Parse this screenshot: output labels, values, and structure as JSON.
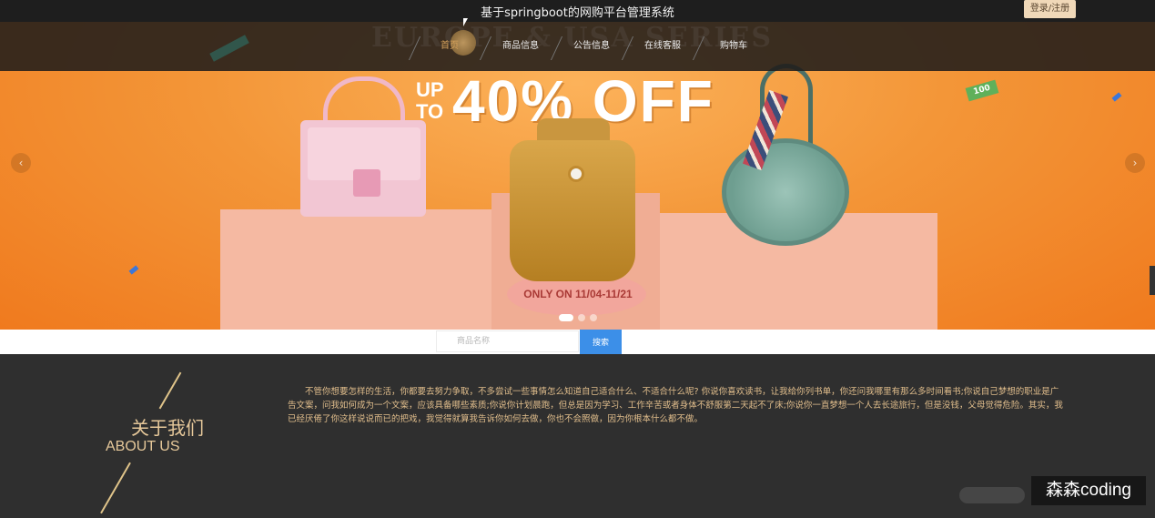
{
  "header": {
    "title": "基于springboot的网购平台管理系统",
    "login_label": "登录/注册"
  },
  "nav": {
    "watermark": "EUROPE & USA SERIES",
    "items": [
      {
        "label": "首页",
        "active": true
      },
      {
        "label": "商品信息",
        "active": false
      },
      {
        "label": "公告信息",
        "active": false
      },
      {
        "label": "在线客服",
        "active": false
      },
      {
        "label": "购物车",
        "active": false
      }
    ]
  },
  "banner": {
    "promo_up": "UP",
    "promo_to": "TO",
    "promo_value": "40% OFF",
    "caption": "ONLY ON 11/04-11/21",
    "tag": "100",
    "prev_arrow": "‹",
    "next_arrow": "›",
    "slide_count": 3,
    "active_slide": 1
  },
  "search": {
    "placeholder": "商品名称",
    "value": "",
    "button_label": "搜索"
  },
  "about": {
    "title": "关于我们",
    "subtitle": "ABOUT US",
    "text": "不管你想要怎样的生活，你都要去努力争取，不多尝试一些事情怎么知道自己适合什么、不适合什么呢? 你说你喜欢读书，让我给你列书单，你还问我哪里有那么多时间看书;你说自己梦想的职业是广告文案，问我如何成为一个文案，应该具备哪些素质;你说你计划晨跑，但总是因为学习、工作辛苦或者身体不舒服第二天起不了床;你说你一直梦想一个人去长途旅行，但是没钱，父母觉得危险。其实，我已经厌倦了你这样说说而已的把戏，我觉得就算我告诉你如何去做，你也不会照做，因为你根本什么都不做。"
  },
  "watermark": "森森coding",
  "colors": {
    "accent": "#d6a25c",
    "search_button": "#3c8fe8",
    "login_button": "#f0d8b8",
    "about_text": "#e1be8c"
  }
}
